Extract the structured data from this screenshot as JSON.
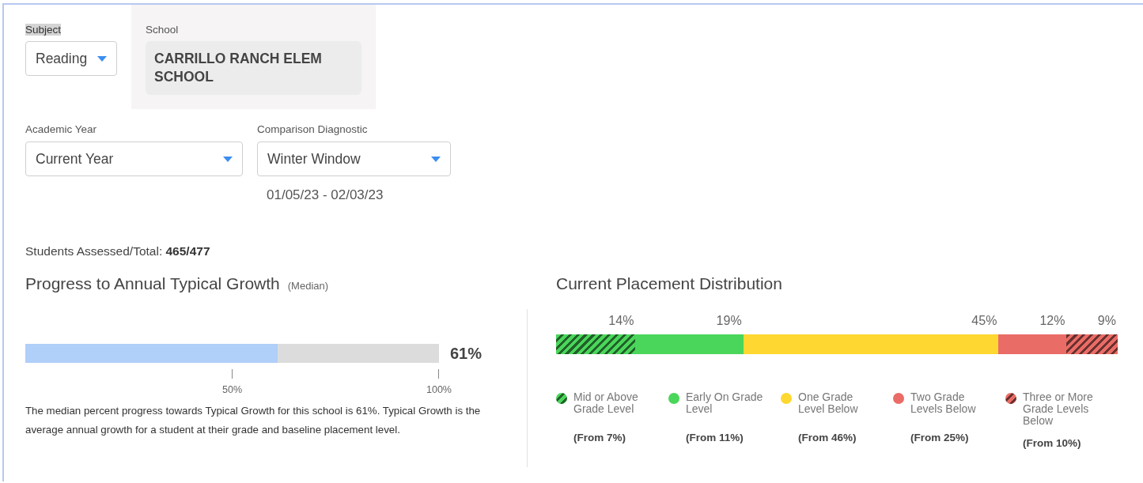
{
  "filters": {
    "subject": {
      "label": "Subject",
      "label_highlighted": true,
      "value": "Reading"
    },
    "school": {
      "label": "School",
      "value": "CARRILLO RANCH ELEM SCHOOL"
    },
    "academic_year": {
      "label": "Academic Year",
      "value": "Current Year"
    },
    "comparison_diagnostic": {
      "label": "Comparison Diagnostic",
      "value": "Winter Window",
      "date_range": "01/05/23 - 02/03/23"
    }
  },
  "students_assessed": {
    "label": "Students Assessed/Total:",
    "value": "465/477"
  },
  "growth": {
    "title": "Progress to Annual Typical Growth",
    "subtitle": "(Median)",
    "level": 0.61,
    "reading": "61%",
    "ticks": [
      {
        "label": "50%"
      },
      {
        "label": "100%"
      }
    ],
    "description": "The median percent progress towards Typical Growth for this school is 61%. Typical Growth is the average annual growth for a student at their grade and baseline placement level."
  },
  "placement": {
    "title": "Current Placement Distribution",
    "segments": [
      {
        "kind": "striped",
        "color": "#4ad65a",
        "percent": "14%",
        "label": "Mid or Above Grade Level",
        "from": "(From 7%)"
      },
      {
        "kind": "solid",
        "color": "#4ad65a",
        "percent": "19%",
        "label": "Early On Grade Level",
        "from": "(From 11%)"
      },
      {
        "kind": "solid",
        "color": "#fed730",
        "percent": "45%",
        "label": "One Grade Level Below",
        "from": "(From 46%)"
      },
      {
        "kind": "solid",
        "color": "#ea6c66",
        "percent": "12%",
        "label": "Two Grade Levels Below",
        "from": "(From 25%)"
      },
      {
        "kind": "striped",
        "color": "#ea6c66",
        "percent": "9%",
        "label": "Three or More Grade Levels Below",
        "from": "(From 10%)"
      }
    ]
  }
}
